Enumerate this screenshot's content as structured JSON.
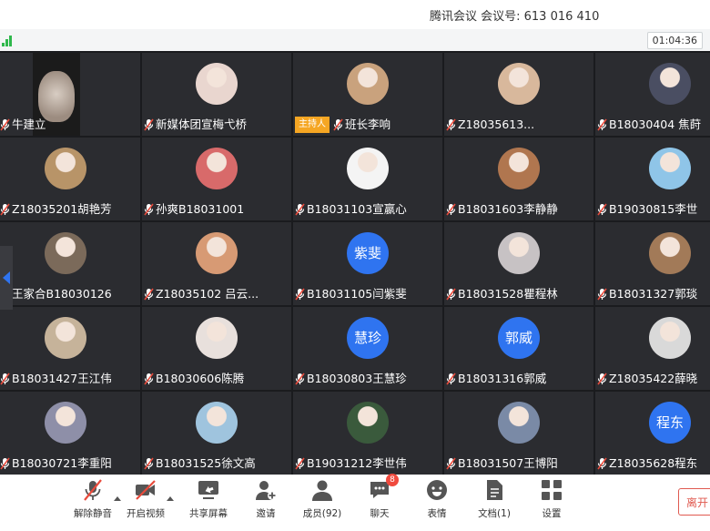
{
  "header": {
    "meeting_info": "腾讯会议  会议号: 613 016 410",
    "timer": "01:04:36"
  },
  "participants": [
    {
      "name": "牛建立",
      "avatar_type": "video"
    },
    {
      "name": "新媒体团宣梅弋桥",
      "avatar_type": "photo",
      "color": "#e9d6cf"
    },
    {
      "name": "班长李响",
      "avatar_type": "photo",
      "color": "#c9a27d",
      "host": true
    },
    {
      "name": "Z18035613...",
      "avatar_type": "photo",
      "color": "#d8b89c"
    },
    {
      "name": "B18030404 焦莳",
      "avatar_type": "photo",
      "color": "#4a4e62"
    },
    {
      "name": "Z18035201胡艳芳",
      "avatar_type": "photo",
      "color": "#b89468"
    },
    {
      "name": "孙爽B18031001",
      "avatar_type": "photo",
      "color": "#d86a6a"
    },
    {
      "name": "B18031103宣嬴心",
      "avatar_type": "photo",
      "color": "#f4f4f4"
    },
    {
      "name": "B18031603李静静",
      "avatar_type": "photo",
      "color": "#b0764f"
    },
    {
      "name": "B19030815李世",
      "avatar_type": "photo",
      "color": "#8fc5e8"
    },
    {
      "name": "王家合B18030126",
      "avatar_type": "photo",
      "color": "#7b6a5a"
    },
    {
      "name": "Z18035102  吕云...",
      "avatar_type": "photo",
      "color": "#d79a74"
    },
    {
      "name": "B18031105闫紫斐",
      "avatar_type": "text",
      "initials": "紫斐"
    },
    {
      "name": "B18031528瞿程林",
      "avatar_type": "photo",
      "color": "#c7c2c4"
    },
    {
      "name": "B18031327郭琰",
      "avatar_type": "photo",
      "color": "#a27a58"
    },
    {
      "name": "B18031427王江伟",
      "avatar_type": "photo",
      "color": "#c6b39a"
    },
    {
      "name": "B18030606陈腾",
      "avatar_type": "photo",
      "color": "#e8e0dc"
    },
    {
      "name": "B18030803王慧珍",
      "avatar_type": "text",
      "initials": "慧珍"
    },
    {
      "name": "B18031316郭威",
      "avatar_type": "text",
      "initials": "郭威"
    },
    {
      "name": "Z18035422薛晓",
      "avatar_type": "photo",
      "color": "#d9d9d9"
    },
    {
      "name": "B18030721李重阳",
      "avatar_type": "photo",
      "color": "#8e8fa8"
    },
    {
      "name": "B18031525徐文高",
      "avatar_type": "photo",
      "color": "#9fc4de"
    },
    {
      "name": "B19031212李世伟",
      "avatar_type": "photo",
      "color": "#3a5a3c"
    },
    {
      "name": "B18031507王博阳",
      "avatar_type": "photo",
      "color": "#7a8aa6"
    },
    {
      "name": "Z18035628程东",
      "avatar_type": "text",
      "initials": "程东"
    }
  ],
  "host_label": "主持人",
  "toolbar": [
    {
      "label": "解除静音",
      "icon": "mic-muted-icon",
      "caret": true
    },
    {
      "label": "开启视频",
      "icon": "camera-off-icon",
      "caret": true
    },
    {
      "label": "共享屏幕",
      "icon": "share-screen-icon"
    },
    {
      "label": "邀请",
      "icon": "invite-user-icon"
    },
    {
      "label": "成员(92)",
      "icon": "members-icon"
    },
    {
      "label": "聊天",
      "icon": "chat-icon",
      "badge": "8"
    },
    {
      "label": "表情",
      "icon": "emoji-icon"
    },
    {
      "label": "文档(1)",
      "icon": "document-icon"
    },
    {
      "label": "设置",
      "icon": "settings-icon"
    }
  ],
  "leave_label": "离开",
  "colors": {
    "accent": "#2f74f0",
    "host": "#f5a623",
    "badge": "#f04a3e",
    "signal": "#2fb84c",
    "leave": "#e05a50"
  }
}
